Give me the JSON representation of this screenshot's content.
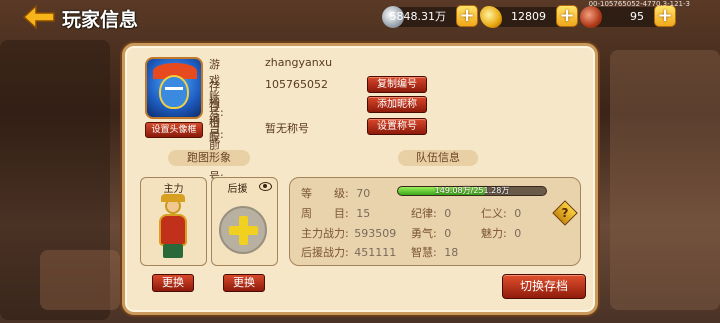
{
  "header": {
    "title": "玩家信息",
    "silver": "5848.31万",
    "gold": "12809",
    "meat": "95",
    "version": "00-105765052-4770.3-121-3"
  },
  "profile": {
    "set_avatar_label": "设置头像框",
    "account_label": "游戏账号:",
    "account_value": "zhangyanxu",
    "save_id_label": "存档编号:",
    "save_id_value": "105765052",
    "nickname_label": "存档昵称:",
    "nickname_value": "",
    "title_label": "当前称号:",
    "title_value": "暂无称号",
    "copy_id_button": "复制编号",
    "add_nickname_button": "添加昵称",
    "set_title_button": "设置称号"
  },
  "sections": {
    "avatar_section": "跑图形象",
    "team_section": "队伍信息"
  },
  "slots": {
    "main_label": "主力",
    "support_label": "后援",
    "swap_label": "更换"
  },
  "stats": {
    "level_label": "等　　级:",
    "level_value": "70",
    "exp_text": "149.08万/251.28万",
    "exp_fraction": 0.593,
    "week_label": "周　　目:",
    "week_value": "15",
    "discipline_label": "纪律:",
    "discipline_value": "0",
    "benevolence_label": "仁义:",
    "benevolence_value": "0",
    "main_power_label": "主力战力:",
    "main_power_value": "593509",
    "courage_label": "勇气:",
    "courage_value": "0",
    "charm_label": "魅力:",
    "charm_value": "0",
    "support_power_label": "后援战力:",
    "support_power_value": "451111",
    "wisdom_label": "智慧:",
    "wisdom_value": "18"
  },
  "switch_save_button": "切换存档"
}
